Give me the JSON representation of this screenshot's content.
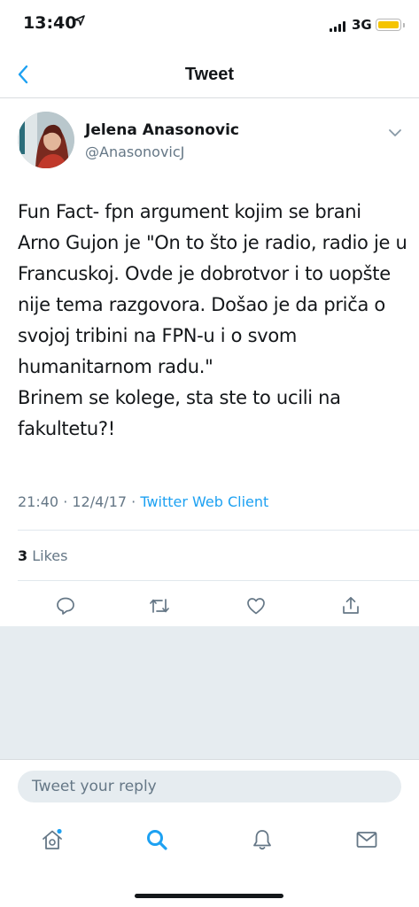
{
  "status_bar": {
    "time": "13:40",
    "network": "3G",
    "battery_color": "#f5c400"
  },
  "nav": {
    "title": "Tweet",
    "accent": "#1da1f2"
  },
  "tweet": {
    "author_name": "Jelena Anasonovic",
    "author_handle": "@AnasonovicJ",
    "text": "Fun Fact- fpn argument kojim se brani Arno Gujon je \"On to što je radio, radio je u Francuskoj. Ovde je dobrotvor i to uopšte nije tema razgovora. Došao je da priča o svojoj tribini na FPN-u i o svom humanitarnom radu.\"\nBrinem se kolege, sta ste to ucili na fakultetu?!",
    "timestamp": "21:40 · 12/4/17 · ",
    "client": "Twitter Web Client",
    "likes_count": "3",
    "likes_label": " Likes"
  },
  "actions": [
    "reply-icon",
    "retweet-icon",
    "like-icon",
    "share-icon"
  ],
  "reply": {
    "placeholder": "Tweet your reply"
  },
  "tabs": [
    "home-icon",
    "search-icon",
    "notifications-icon",
    "messages-icon"
  ]
}
